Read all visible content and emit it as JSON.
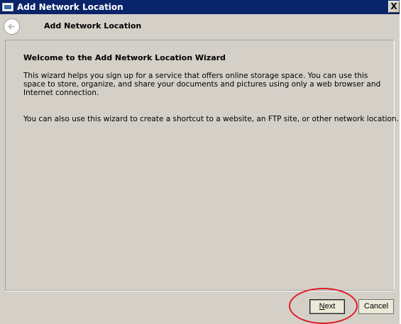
{
  "window": {
    "title": "Add Network Location",
    "close_label": "X"
  },
  "navbar": {
    "title": "Add Network Location"
  },
  "content": {
    "heading": "Welcome to the Add Network Location Wizard",
    "paragraph1": "This wizard helps you sign up for a service that offers online storage space.  You can use this space to store, organize, and share your documents and pictures using only a web browser and Internet connection.",
    "paragraph2": "You can also use this wizard to create a shortcut to a website, an FTP site, or other network location."
  },
  "buttons": {
    "next_label": "Next",
    "cancel_label": "Cancel"
  },
  "colors": {
    "title_bar": "#0a246a",
    "dialog_bg": "#d4d0c8",
    "annotation": "#e01b24"
  }
}
